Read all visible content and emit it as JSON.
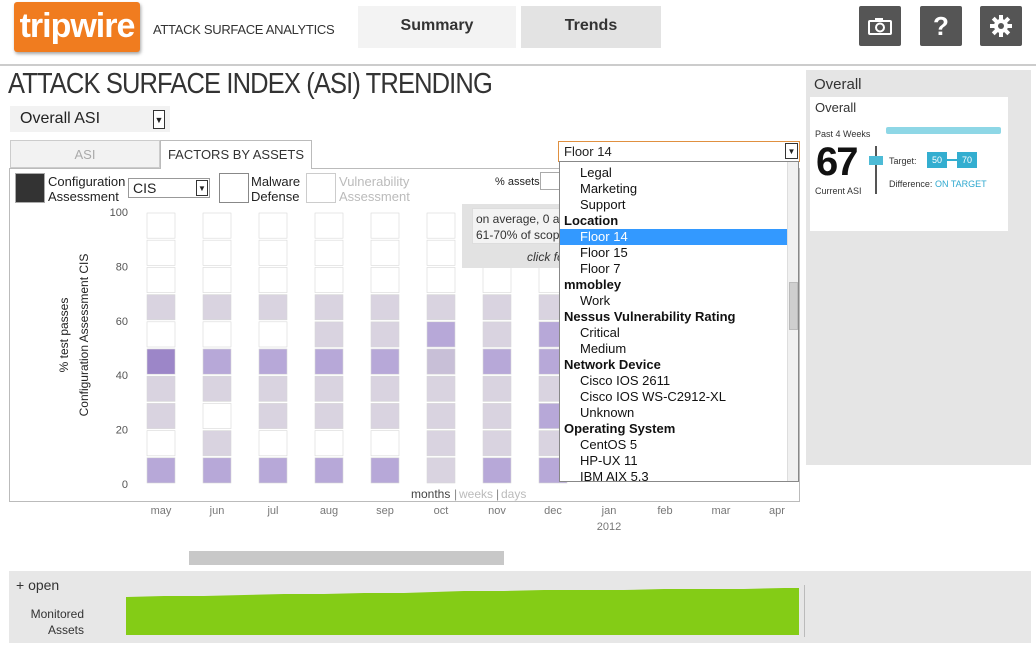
{
  "header": {
    "logo_text": "tripwire",
    "logo_sub": "ATTACK SURFACE ANALYTICS",
    "tabs": [
      {
        "label": "Summary"
      },
      {
        "label": "Trends"
      }
    ],
    "icons": [
      "camera-icon",
      "help-icon",
      "gear-icon"
    ],
    "help_glyph": "?"
  },
  "page": {
    "title": "ATTACK SURFACE INDEX (ASI) TRENDING",
    "asi_select": "Overall ASI",
    "subtabs": [
      "ASI",
      "FACTORS BY ASSETS"
    ]
  },
  "legend": {
    "config": "Configuration Assessment",
    "cis_select": "CIS",
    "malware": "Malware Defense",
    "vulnerability": "Vulnerability Assessment",
    "pct_assets": "% assets:"
  },
  "tooltip": {
    "line1": "on average, 0 a",
    "line2": "61-70% of scop",
    "link": "click fo"
  },
  "granularity": {
    "months": "months",
    "weeks": "weeks",
    "days": "days",
    "sep": "|"
  },
  "dropdown": {
    "selected": "Floor 14",
    "items": [
      {
        "type": "opt",
        "label": "Legal"
      },
      {
        "type": "opt",
        "label": "Marketing"
      },
      {
        "type": "opt",
        "label": "Support"
      },
      {
        "type": "group",
        "label": "Location"
      },
      {
        "type": "opt",
        "label": "Floor 14",
        "selected": true
      },
      {
        "type": "opt",
        "label": "Floor 15"
      },
      {
        "type": "opt",
        "label": "Floor 7"
      },
      {
        "type": "group",
        "label": "mmobley"
      },
      {
        "type": "opt",
        "label": "Work"
      },
      {
        "type": "group",
        "label": "Nessus Vulnerability Rating"
      },
      {
        "type": "opt",
        "label": "Critical"
      },
      {
        "type": "opt",
        "label": "Medium"
      },
      {
        "type": "group",
        "label": "Network Device"
      },
      {
        "type": "opt",
        "label": "Cisco IOS 2611"
      },
      {
        "type": "opt",
        "label": "Cisco IOS WS-C2912-XL"
      },
      {
        "type": "opt",
        "label": "Unknown"
      },
      {
        "type": "group",
        "label": "Operating System"
      },
      {
        "type": "opt",
        "label": "CentOS 5"
      },
      {
        "type": "opt",
        "label": "HP-UX 11"
      },
      {
        "type": "opt",
        "label": "IBM AIX 5.3"
      }
    ]
  },
  "overall": {
    "panel_title": "Overall",
    "card_title": "Overall",
    "past_label": "Past 4 Weeks",
    "asi_value": "67",
    "current_label": "Current ASI",
    "target_label": "Target:",
    "target_low": "50",
    "target_high": "70",
    "difference_label": "Difference:",
    "difference_value": "ON TARGET"
  },
  "bottom": {
    "toggle": "+ open",
    "monitored_label": "Monitored Assets"
  },
  "chart_data": {
    "type": "heatmap",
    "ylabel": "% test passes",
    "ylabel2": "Configuration Assessment CIS",
    "yticks": [
      0,
      20,
      40,
      60,
      80,
      100
    ],
    "ylim": [
      0,
      100
    ],
    "x_labels": [
      "may",
      "jun",
      "jul",
      "aug",
      "sep",
      "oct",
      "nov",
      "dec",
      "jan",
      "feb",
      "mar",
      "apr"
    ],
    "x_sublabel": {
      "jan": "2012"
    },
    "bins": [
      "0-10",
      "10-20",
      "20-30",
      "30-40",
      "40-50",
      "50-60",
      "60-70",
      "70-80",
      "80-90",
      "90-100"
    ],
    "colors": [
      "#ffffff",
      "#d9d3e0",
      "#c8bfd7",
      "#b7a8d8",
      "#9c86c8"
    ],
    "intensity": [
      [
        3,
        0,
        1,
        1,
        4,
        0,
        1,
        0,
        0,
        0
      ],
      [
        3,
        1,
        0,
        1,
        3,
        0,
        1,
        0,
        0,
        0
      ],
      [
        3,
        0,
        1,
        1,
        3,
        0,
        1,
        0,
        0,
        0
      ],
      [
        3,
        0,
        1,
        1,
        3,
        1,
        1,
        0,
        0,
        0
      ],
      [
        3,
        0,
        1,
        1,
        3,
        1,
        1,
        0,
        0,
        0
      ],
      [
        1,
        1,
        1,
        1,
        2,
        3,
        1,
        0,
        0,
        0
      ],
      [
        3,
        1,
        1,
        1,
        3,
        1,
        1,
        0,
        0,
        0
      ],
      [
        3,
        1,
        3,
        1,
        3,
        3,
        1,
        0,
        0,
        0
      ]
    ]
  }
}
